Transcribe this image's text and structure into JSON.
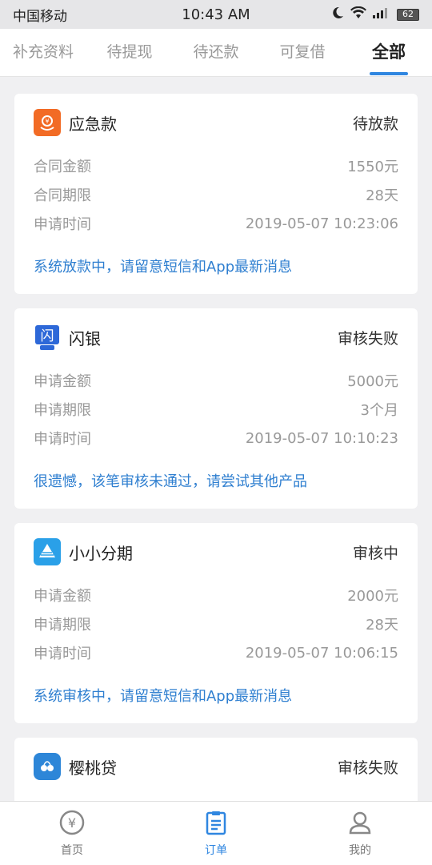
{
  "status_bar": {
    "carrier": "中国移动",
    "time": "10:43 AM",
    "battery": "62"
  },
  "tabs": [
    {
      "label": "补充资料",
      "active": false
    },
    {
      "label": "待提现",
      "active": false
    },
    {
      "label": "待还款",
      "active": false
    },
    {
      "label": "可复借",
      "active": false
    },
    {
      "label": "全部",
      "active": true
    }
  ],
  "orders": [
    {
      "name": "应急款",
      "status": "待放款",
      "logo_icon": "coin-hand-icon",
      "logo_color": "#f26b25",
      "rows": [
        {
          "label": "合同金额",
          "value": "1550元"
        },
        {
          "label": "合同期限",
          "value": "28天"
        },
        {
          "label": "申请时间",
          "value": "2019-05-07 10:23:06"
        }
      ],
      "message": "系统放款中，请留意短信和App最新消息"
    },
    {
      "name": "闪银",
      "status": "审核失败",
      "logo_icon": "shanyin-logo-icon",
      "logo_color": "#2d68d8",
      "rows": [
        {
          "label": "申请金额",
          "value": "5000元"
        },
        {
          "label": "申请期限",
          "value": "3个月"
        },
        {
          "label": "申请时间",
          "value": "2019-05-07 10:10:23"
        }
      ],
      "message": "很遗憾，该笔审核未通过，请尝试其他产品"
    },
    {
      "name": "小小分期",
      "status": "审核中",
      "logo_icon": "pyramid-logo-icon",
      "logo_color": "#2aa0e8",
      "rows": [
        {
          "label": "申请金额",
          "value": "2000元"
        },
        {
          "label": "申请期限",
          "value": "28天"
        },
        {
          "label": "申请时间",
          "value": "2019-05-07 10:06:15"
        }
      ],
      "message": "系统审核中，请留意短信和App最新消息"
    },
    {
      "name": "樱桃贷",
      "status": "审核失败",
      "logo_icon": "cherry-logo-icon",
      "logo_color": "#2d86d8",
      "rows": [],
      "message": ""
    }
  ],
  "bottom_nav": [
    {
      "label": "首页",
      "icon": "yen-coin-icon",
      "active": false
    },
    {
      "label": "订单",
      "icon": "clipboard-icon",
      "active": true
    },
    {
      "label": "我的",
      "icon": "user-icon",
      "active": false
    }
  ],
  "colors": {
    "accent": "#2f86e0",
    "message": "#2f7fd0"
  }
}
